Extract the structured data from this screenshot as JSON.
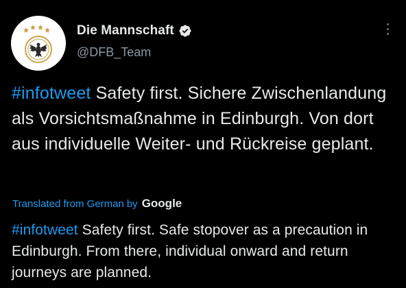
{
  "account": {
    "display_name": "Die Mannschaft",
    "handle": "@DFB_Team",
    "verified": true
  },
  "icons": {
    "avatar": "dfb-eagle-logo-icon",
    "verified": "verified-badge-icon",
    "more": "more-options-icon"
  },
  "tweet": {
    "original": {
      "hashtag": "#infotweet",
      "text": " Safety first. Sichere Zwischenlandung als Vorsichtsmaßnahme in Edinburgh. Von dort aus individuelle Weiter- und Rückreise geplant."
    },
    "translation": {
      "label": "Translated from German",
      "by": "by",
      "provider": "Google",
      "hashtag": "#infotweet",
      "text": " Safety first. Safe stopover as a precaution in Edinburgh. From there, individual onward and return journeys are planned."
    }
  },
  "colors": {
    "background": "#000000",
    "text": "#e7e9ea",
    "secondary": "#8b98a5",
    "accent": "#1d9bf0"
  }
}
